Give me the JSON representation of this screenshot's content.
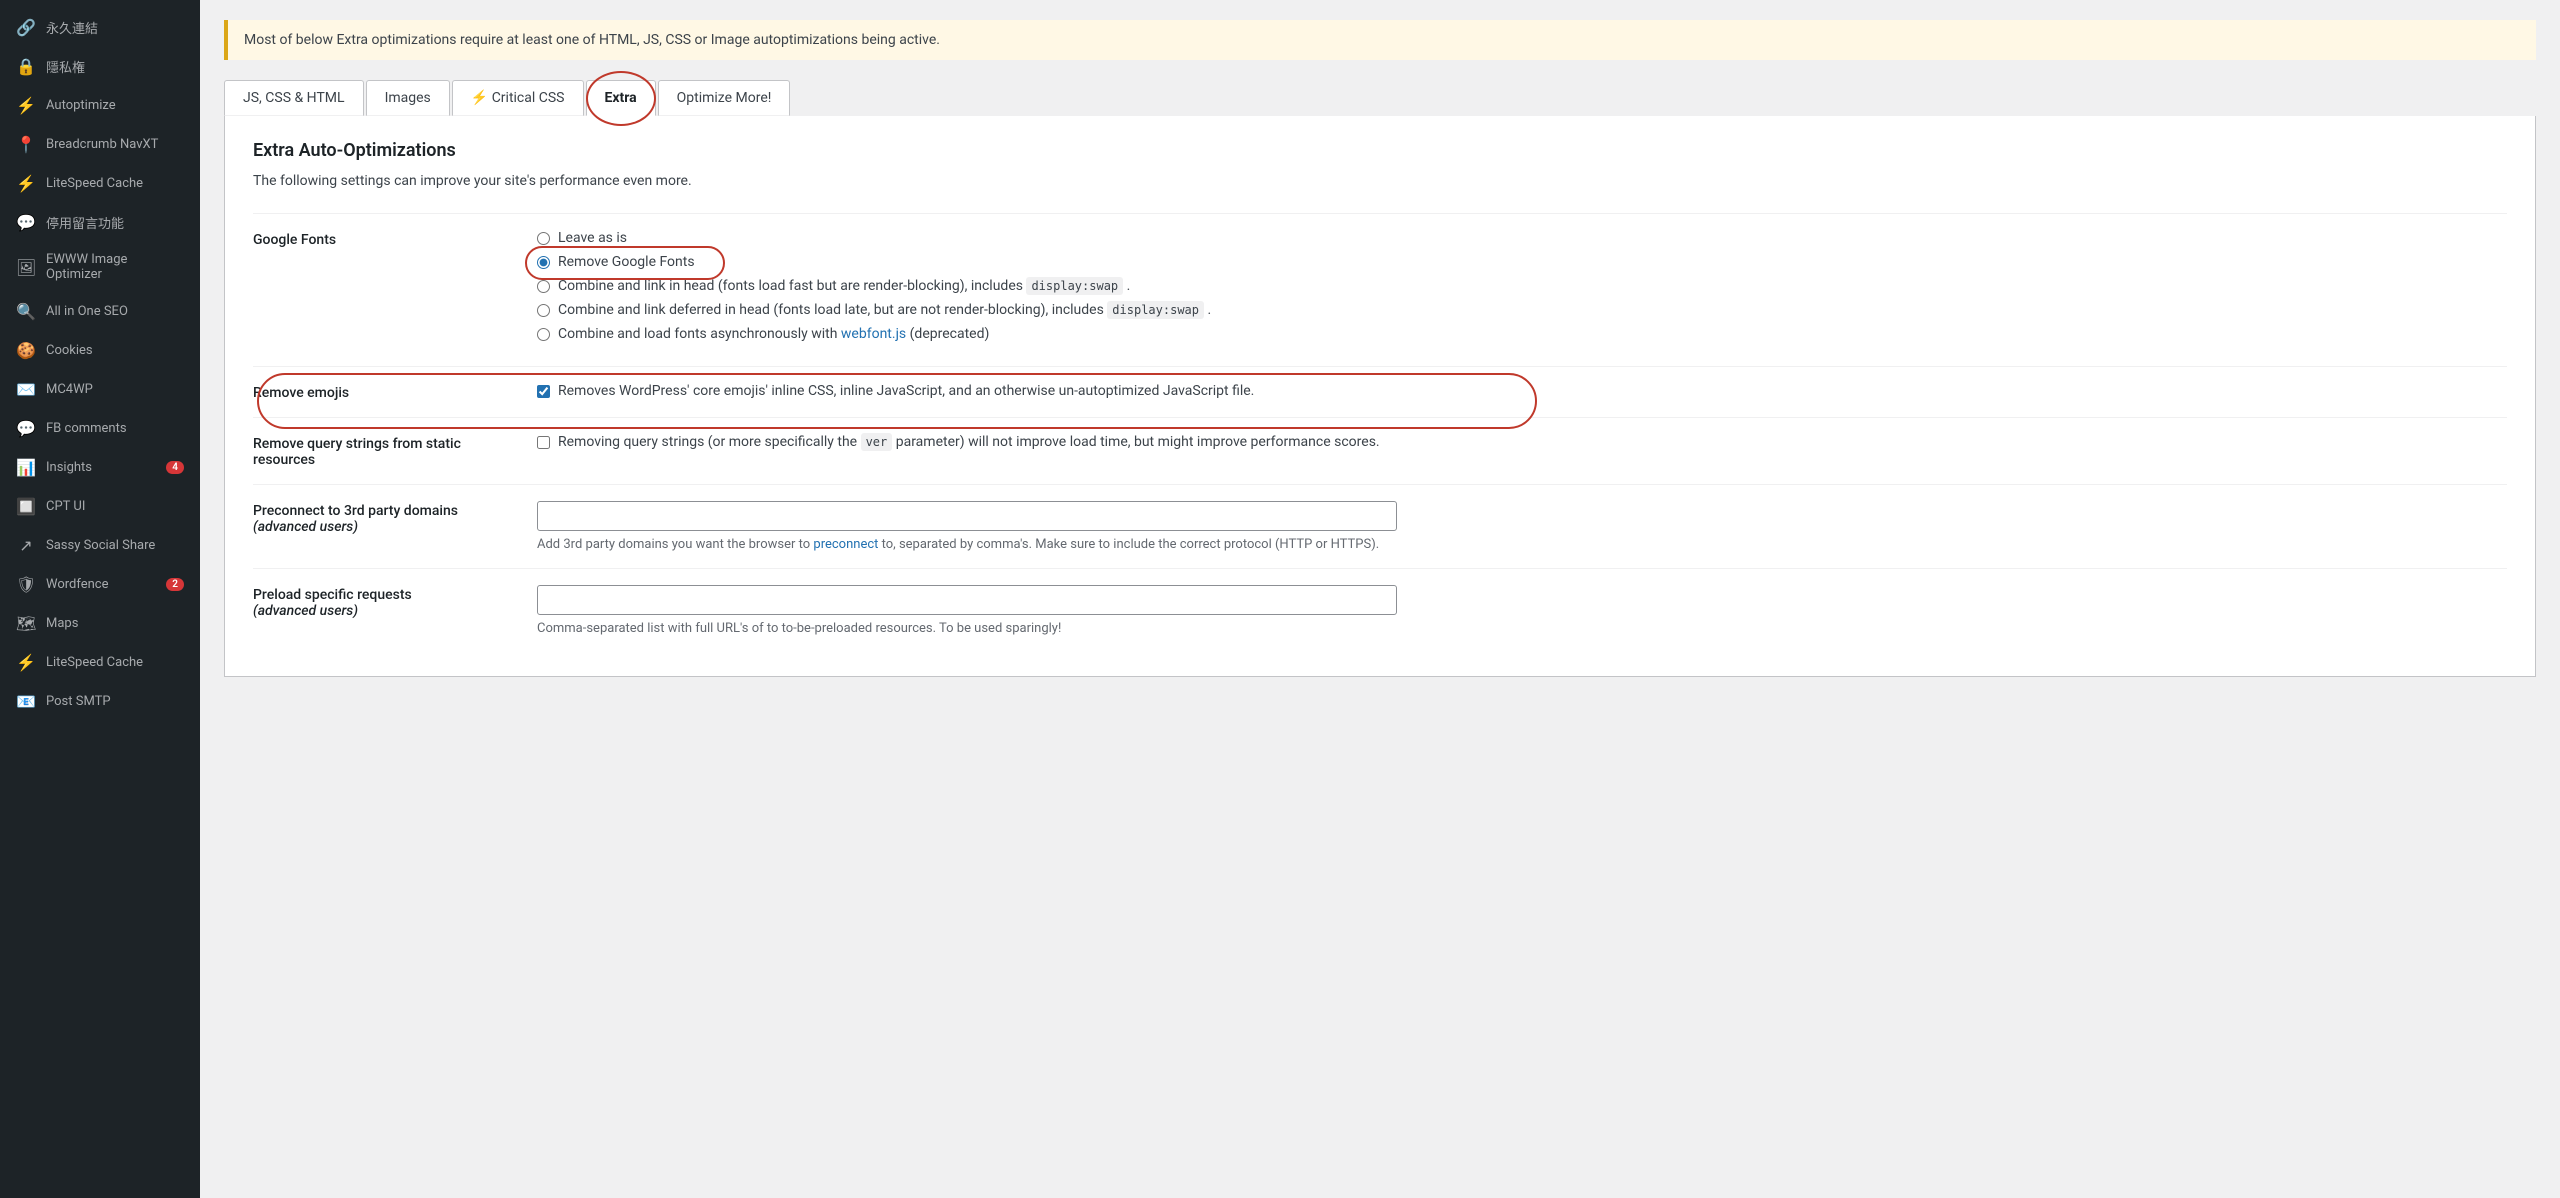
{
  "sidebar": {
    "items": [
      {
        "id": "permalinks",
        "label": "永久連結",
        "icon": "🔗",
        "badge": null
      },
      {
        "id": "privacy",
        "label": "隱私権",
        "icon": "🔒",
        "badge": null
      },
      {
        "id": "autoptimize",
        "label": "Autoptimize",
        "icon": "⚡",
        "badge": null
      },
      {
        "id": "breadcrumb",
        "label": "Breadcrumb NavXT",
        "icon": "📍",
        "badge": null
      },
      {
        "id": "litespeed",
        "label": "LiteSpeed Cache",
        "icon": "⚡",
        "badge": null
      },
      {
        "id": "stopcomments",
        "label": "停用留言功能",
        "icon": "💬",
        "badge": null
      },
      {
        "id": "ewww",
        "label": "EWWW Image Optimizer",
        "icon": "🖼",
        "badge": null
      },
      {
        "id": "allinoneseo",
        "label": "All in One SEO",
        "icon": "🔍",
        "badge": null
      },
      {
        "id": "cookies",
        "label": "Cookies",
        "icon": "🍪",
        "badge": null
      },
      {
        "id": "mc4wp",
        "label": "MC4WP",
        "icon": "✉️",
        "badge": null
      },
      {
        "id": "fbcomments",
        "label": "FB comments",
        "icon": "💬",
        "badge": null
      },
      {
        "id": "insights",
        "label": "Insights",
        "icon": "📊",
        "badge": "4"
      },
      {
        "id": "cptui",
        "label": "CPT UI",
        "icon": "🔲",
        "badge": null
      },
      {
        "id": "sassysocialshare",
        "label": "Sassy Social Share",
        "icon": "↗",
        "badge": null
      },
      {
        "id": "wordfence",
        "label": "Wordfence",
        "icon": "🛡",
        "badge": "2"
      },
      {
        "id": "maps",
        "label": "Maps",
        "icon": "🗺",
        "badge": null
      },
      {
        "id": "litespeed2",
        "label": "LiteSpeed Cache",
        "icon": "⚡",
        "badge": null
      },
      {
        "id": "postsmtp",
        "label": "Post SMTP",
        "icon": "📧",
        "badge": null
      }
    ]
  },
  "warning": {
    "text": "Most of below Extra optimizations require at least one of HTML, JS, CSS or Image autoptimizations being active."
  },
  "tabs": [
    {
      "id": "jscsshtml",
      "label": "JS, CSS & HTML",
      "active": false
    },
    {
      "id": "images",
      "label": "Images",
      "active": false
    },
    {
      "id": "criticalcss",
      "label": "⚡ Critical CSS",
      "active": false,
      "lightning": true
    },
    {
      "id": "extra",
      "label": "Extra",
      "active": true
    },
    {
      "id": "optimizemore",
      "label": "Optimize More!",
      "active": false
    }
  ],
  "panel": {
    "title": "Extra Auto-Optimizations",
    "description": "The following settings can improve your site's performance even more.",
    "google_fonts": {
      "label": "Google Fonts",
      "options": [
        {
          "id": "leave",
          "label": "Leave as is",
          "checked": false
        },
        {
          "id": "remove",
          "label": "Remove Google Fonts",
          "checked": true
        },
        {
          "id": "combine_head",
          "label": "Combine and link in head (fonts load fast but are render-blocking), includes",
          "code": "display:swap",
          "suffix": ".",
          "checked": false
        },
        {
          "id": "combine_defer",
          "label": "Combine and link deferred in head (fonts load late, but are not render-blocking), includes",
          "code": "display:swap",
          "suffix": ".",
          "checked": false
        },
        {
          "id": "combine_async",
          "label": "Combine and load fonts asynchronously with",
          "link_text": "webfont.js",
          "link_href": "#",
          "suffix": "(deprecated)",
          "checked": false
        }
      ]
    },
    "remove_emojis": {
      "label": "Remove emojis",
      "checked": true,
      "description": "Removes WordPress' core emojis' inline CSS, inline JavaScript, and an otherwise un-autoptimized JavaScript file."
    },
    "remove_query_strings": {
      "label": "Remove query strings from static resources",
      "checked": false,
      "description": "Removing query strings (or more specifically the",
      "code": "ver",
      "description2": "parameter) will not improve load time, but might improve performance scores."
    },
    "preconnect": {
      "label": "Preconnect to 3rd party domains",
      "sublabel": "(advanced users)",
      "value": "",
      "placeholder": "",
      "description": "Add 3rd party domains you want the browser to",
      "link_text": "preconnect",
      "link_href": "#",
      "description2": "to, separated by comma's. Make sure to include the correct protocol (HTTP or HTTPS)."
    },
    "preload": {
      "label": "Preload specific requests",
      "sublabel": "(advanced users)",
      "value": "",
      "placeholder": "",
      "description": "Comma-separated list with full URL's of to to-be-preloaded resources. To be used sparingly!"
    }
  }
}
